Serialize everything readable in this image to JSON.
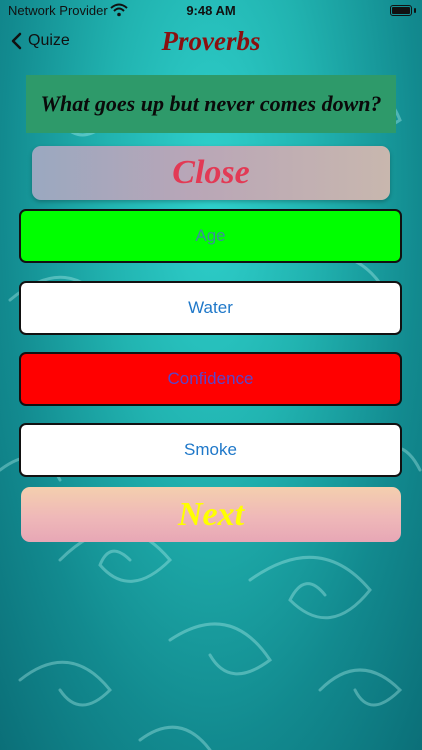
{
  "status_bar": {
    "carrier": "Network Provider",
    "time": "9:48 AM",
    "wifi_icon": "wifi-icon",
    "battery_icon": "battery-icon"
  },
  "nav": {
    "back_label": "Quize",
    "back_icon": "chevron-left-icon",
    "title": "Proverbs"
  },
  "question": {
    "text": "What goes up but never comes down?"
  },
  "close_button": {
    "label": "Close"
  },
  "answers": [
    {
      "label": "Age",
      "background": "#00ff00",
      "text_color": "#3a8f9a"
    },
    {
      "label": "Water",
      "background": "#ffffff",
      "text_color": "#1f78c9"
    },
    {
      "label": "Confidence",
      "background": "#ff0000",
      "text_color": "#5b45c9"
    },
    {
      "label": "Smoke",
      "background": "#ffffff",
      "text_color": "#1f78c9"
    }
  ],
  "next_button": {
    "label": "Next"
  },
  "colors": {
    "title": "#8a1010",
    "question_bg": "#2e9a6a",
    "close_text": "#e23a55",
    "next_text": "#ffff00"
  }
}
